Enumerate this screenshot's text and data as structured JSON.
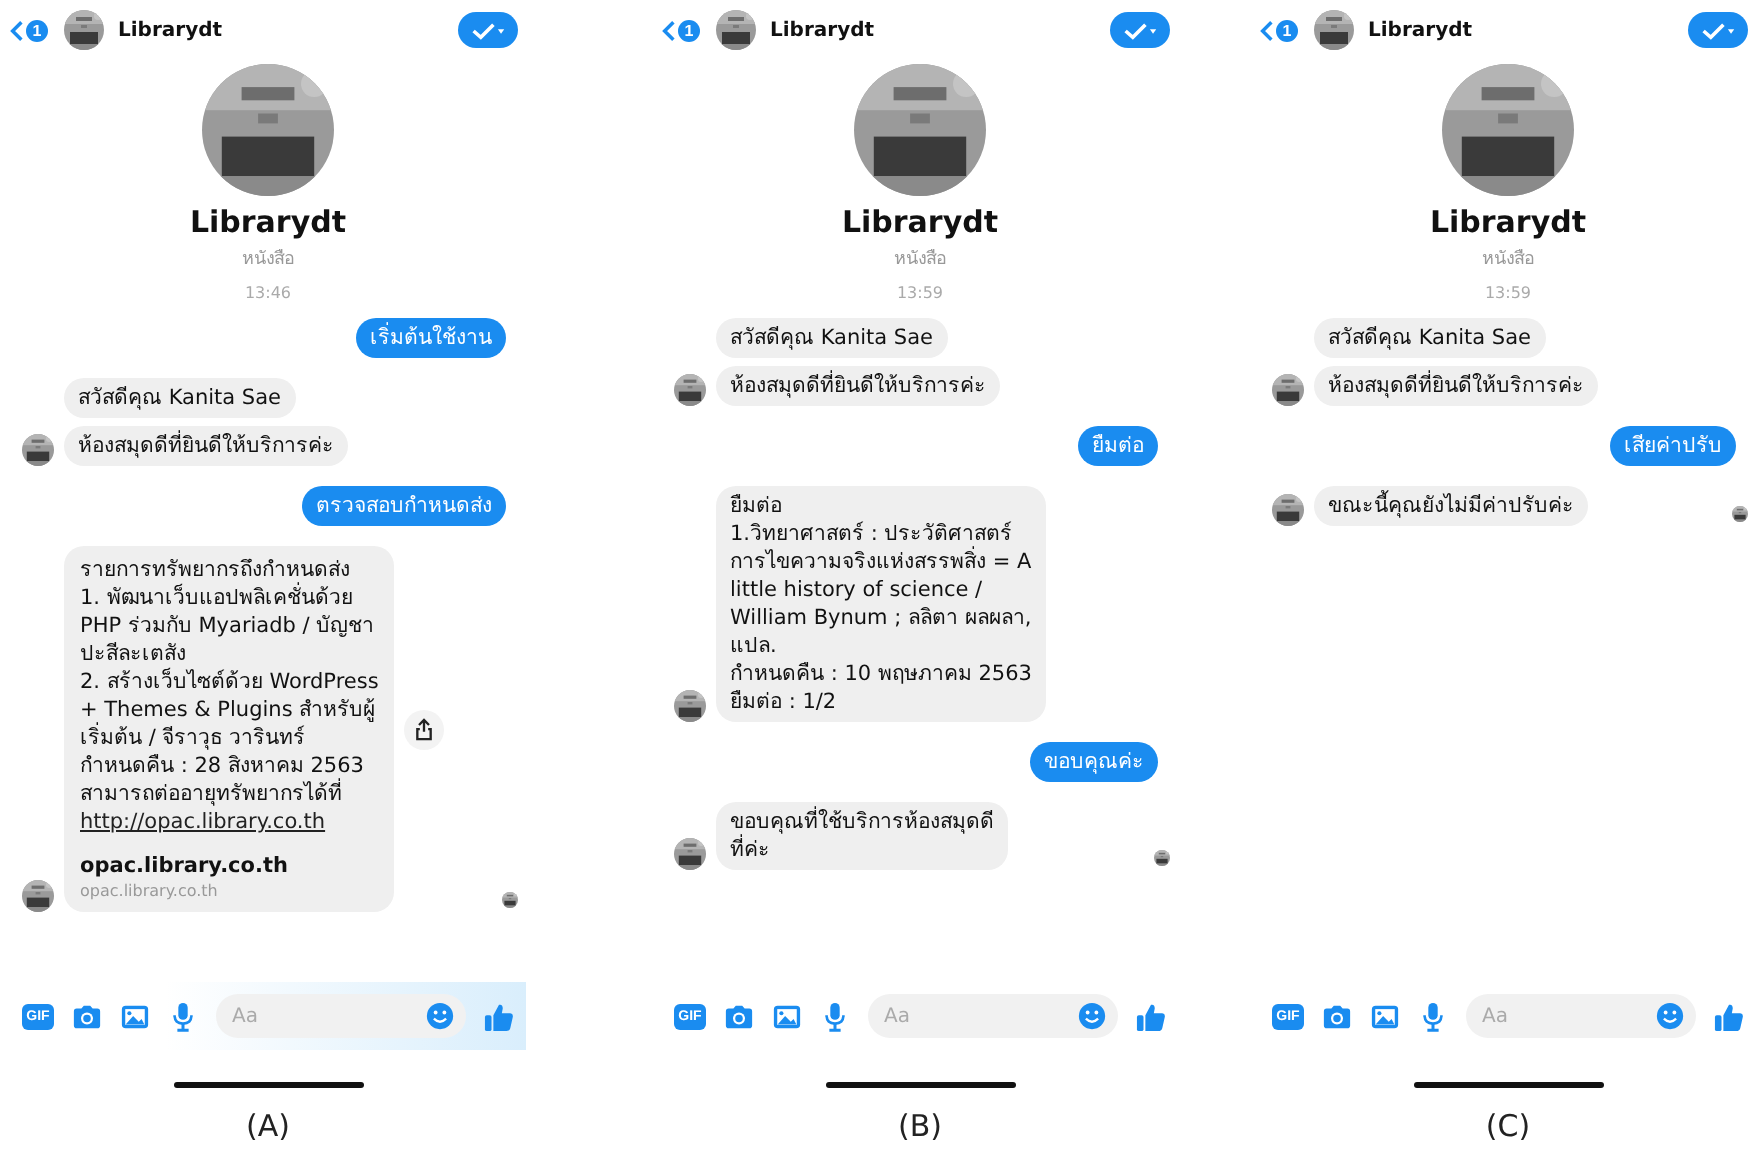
{
  "panels": [
    {
      "caption": "(A)",
      "header": {
        "back_badge": "1",
        "name": "Librarydt"
      },
      "profile": {
        "name": "Librarydt",
        "subtitle": "หนังสือ"
      },
      "time": "13:46",
      "seen": true,
      "composer": {
        "gif": "GIF",
        "placeholder": "Aa"
      },
      "messages": [
        {
          "kind": "out",
          "text": "เริ่มต้นใช้งาน"
        },
        {
          "kind": "in",
          "text": "สวัสดีคุณ Kanita Sae",
          "avatar": false
        },
        {
          "kind": "in",
          "text": "ห้องสมุดดีที่ยินดีให้บริการค่ะ",
          "avatar": true
        },
        {
          "kind": "out",
          "text": "ตรวจสอบกำหนดส่ง"
        },
        {
          "kind": "link",
          "text": "รายการทรัพยากรถึงกำหนดส่ง\n1. พัฒนาเว็บแอปพลิเคชั่นด้วย\nPHP ร่วมกับ Myariadb / บัญชา\nปะสีละเตสัง\n2. สร้างเว็บไซต์ด้วย WordPress\n+ Themes & Plugins สำหรับผู้\nเริ่มต้น / จีราวุธ วารินทร์\nกำหนดคืน : 28 สิงหาคม 2563\nสามารถต่ออายุทรัพยากรได้ที่",
          "link": "http://opac.library.co.th",
          "preview_title": "opac.library.co.th",
          "preview_domain": "opac.library.co.th",
          "avatar": true,
          "share": true
        }
      ]
    },
    {
      "caption": "(B)",
      "header": {
        "back_badge": "1",
        "name": "Librarydt"
      },
      "profile": {
        "name": "Librarydt",
        "subtitle": "หนังสือ"
      },
      "time": "13:59",
      "seen": true,
      "composer": {
        "gif": "GIF",
        "placeholder": "Aa"
      },
      "messages": [
        {
          "kind": "in",
          "text": "สวัสดีคุณ Kanita Sae",
          "avatar": false
        },
        {
          "kind": "in",
          "text": "ห้องสมุดดีที่ยินดีให้บริการค่ะ",
          "avatar": true
        },
        {
          "kind": "out",
          "text": "ยืมต่อ"
        },
        {
          "kind": "in",
          "text": "ยืมต่อ\n1.วิทยาศาสตร์ : ประวัติศาสตร์\nการไขความจริงแห่งสรรพสิ่ง = A\nlittle history of science /\nWilliam Bynum ; ลลิตา ผลผลา,\nแปล.\nกำหนดคืน : 10 พฤษภาคม 2563\nยืมต่อ : 1/2",
          "avatar": true
        },
        {
          "kind": "out",
          "text": "ขอบคุณค่ะ"
        },
        {
          "kind": "in",
          "text": "ขอบคุณที่ใช้บริการห้องสมุดดี\nที่ค่ะ",
          "avatar": true
        }
      ]
    },
    {
      "caption": "(C)",
      "header": {
        "back_badge": "1",
        "name": "Librarydt"
      },
      "profile": {
        "name": "Librarydt",
        "subtitle": "หนังสือ"
      },
      "time": "13:59",
      "seen": true,
      "composer": {
        "gif": "GIF",
        "placeholder": "Aa"
      },
      "messages": [
        {
          "kind": "in",
          "text": "สวัสดีคุณ Kanita Sae",
          "avatar": false
        },
        {
          "kind": "in",
          "text": "ห้องสมุดดีที่ยินดีให้บริการค่ะ",
          "avatar": true
        },
        {
          "kind": "out",
          "text": "เสียค่าปรับ"
        },
        {
          "kind": "in",
          "text": "ขณะนี้คุณยังไม่มีค่าปรับค่ะ",
          "avatar": true
        }
      ]
    }
  ]
}
